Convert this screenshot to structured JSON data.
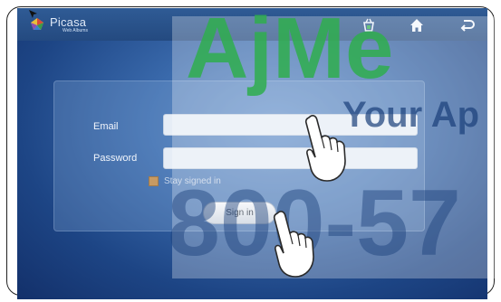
{
  "app": {
    "name": "Picasa",
    "subtitle": "Web Albums"
  },
  "toolbar": {
    "icons": [
      "basket-icon",
      "home-icon",
      "back-icon"
    ]
  },
  "login": {
    "email_label": "Email",
    "email_value": "",
    "password_label": "Password",
    "password_value": "",
    "stay_signed_in_label": "Stay signed in",
    "stay_signed_in_checked": false,
    "sign_in_label": "Sign in"
  },
  "watermark": {
    "brand": "AjMe",
    "tagline": "Your Ap",
    "phone": "800-57"
  },
  "colors": {
    "background": "#1d4585",
    "topbar": "#2a5289",
    "watermark_green": "#2fae4e",
    "watermark_blue": "#1a3f7a"
  }
}
